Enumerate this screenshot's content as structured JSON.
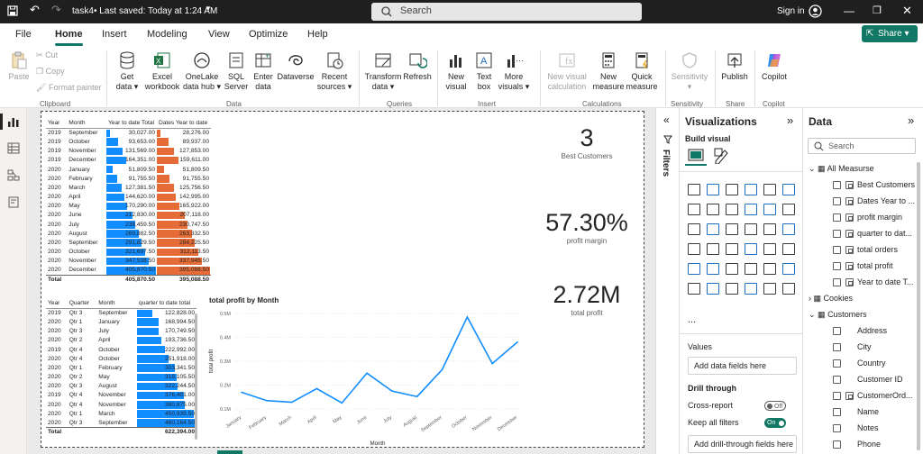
{
  "titlebar": {
    "file_name": "task4",
    "saved": "• Last saved: Today at 1:24 AM",
    "search": "Search",
    "signin": "Sign in"
  },
  "menu": [
    "File",
    "Home",
    "Insert",
    "Modeling",
    "View",
    "Optimize",
    "Help"
  ],
  "share": "Share",
  "ribbon": {
    "paste": "Paste",
    "cut": "Cut",
    "copy": "Copy",
    "format_painter": "Format painter",
    "get_data": "Get\ndata ▾",
    "excel": "Excel\nworkbook",
    "onelake": "OneLake\ndata hub ▾",
    "sql": "SQL\nServer",
    "enter_data": "Enter\ndata",
    "dataverse": "Dataverse",
    "recent": "Recent\nsources ▾",
    "transform": "Transform\ndata ▾",
    "refresh": "Refresh",
    "new_visual": "New\nvisual",
    "text_box": "Text\nbox",
    "more_visuals": "More\nvisuals ▾",
    "new_visual_calc": "New visual\ncalculation",
    "new_measure": "New\nmeasure",
    "quick_measure": "Quick\nmeasure",
    "sensitivity": "Sensitivity\n▾",
    "publish": "Publish",
    "copilot": "Copilot",
    "groups": {
      "clipboard": "Clipboard",
      "data": "Data",
      "queries": "Queries",
      "insert": "Insert",
      "calculations": "Calculations",
      "sensitivity": "Sensitivity",
      "share": "Share",
      "copilot": "Copilot"
    }
  },
  "matrix1": {
    "headers": [
      "Year",
      "Month",
      "Year to date Total",
      "Dates Year to date"
    ],
    "rows": [
      [
        "2019",
        "September",
        "30,027.00",
        "28,276.00"
      ],
      [
        "2019",
        "October",
        "93,653.00",
        "89,937.00"
      ],
      [
        "2019",
        "November",
        "131,569.00",
        "127,853.00"
      ],
      [
        "2019",
        "December",
        "164,351.00",
        "159,611.00"
      ],
      [
        "2020",
        "January",
        "51,809.50",
        "51,809.50"
      ],
      [
        "2020",
        "February",
        "91,755.50",
        "91,755.50"
      ],
      [
        "2020",
        "March",
        "127,381.50",
        "125,756.50"
      ],
      [
        "2020",
        "April",
        "144,620.00",
        "142,995.00"
      ],
      [
        "2020",
        "May",
        "170,290.00",
        "165,922.00"
      ],
      [
        "2020",
        "June",
        "212,830.00",
        "207,118.00"
      ],
      [
        "2020",
        "July",
        "238,459.50",
        "230,747.50"
      ],
      [
        "2020",
        "August",
        "269,882.50",
        "263,332.50"
      ],
      [
        "2020",
        "September",
        "291,829.50",
        "284,225.50"
      ],
      [
        "2020",
        "October",
        "321,697.50",
        "312,113.50"
      ],
      [
        "2020",
        "November",
        "347,538.50",
        "337,945.50"
      ],
      [
        "2020",
        "December",
        "405,870.50",
        "395,088.50"
      ]
    ],
    "total": [
      "Total",
      "",
      "405,870.50",
      "395,088.50"
    ]
  },
  "matrix2": {
    "headers": [
      "Year",
      "Quarter",
      "Month",
      "quarter to date total"
    ],
    "rows": [
      [
        "2019",
        "Qtr 3",
        "September",
        "122,828.00"
      ],
      [
        "2020",
        "Qtr 1",
        "January",
        "168,994.50"
      ],
      [
        "2020",
        "Qtr 3",
        "July",
        "170,749.50"
      ],
      [
        "2020",
        "Qtr 2",
        "April",
        "193,736.50"
      ],
      [
        "2019",
        "Qtr 4",
        "October",
        "222,992.00"
      ],
      [
        "2020",
        "Qtr 4",
        "October",
        "251,918.00"
      ],
      [
        "2020",
        "Qtr 1",
        "February",
        "303,341.50"
      ],
      [
        "2020",
        "Qtr 2",
        "May",
        "318,105.50"
      ],
      [
        "2020",
        "Qtr 3",
        "August",
        "322,244.50"
      ],
      [
        "2019",
        "Qtr 4",
        "November",
        "376,401.00"
      ],
      [
        "2020",
        "Qtr 4",
        "November",
        "380,875.00"
      ],
      [
        "2020",
        "Qtr 1",
        "March",
        "450,939.50"
      ],
      [
        "2020",
        "Qtr 3",
        "September",
        "460,164.50"
      ]
    ],
    "total": [
      "Total",
      "",
      "",
      "622,394.00"
    ]
  },
  "cards": [
    {
      "value": "3",
      "label": "Best Customers"
    },
    {
      "value": "57.30%",
      "label": "profit margin"
    },
    {
      "value": "2.72M",
      "label": "total profit"
    }
  ],
  "chart_data": {
    "type": "line",
    "title": "total profit by Month",
    "xlabel": "Month",
    "ylabel": "total profit",
    "categories": [
      "January",
      "February",
      "March",
      "April",
      "May",
      "June",
      "July",
      "August",
      "September",
      "October",
      "November",
      "December"
    ],
    "values": [
      170000,
      135000,
      128000,
      185000,
      125000,
      250000,
      175000,
      152000,
      265000,
      485000,
      290000,
      380000
    ],
    "yticks": [
      "0.1M",
      "0.2M",
      "0.3M",
      "0.4M",
      "0.5M"
    ],
    "ylim": [
      100000,
      500000
    ],
    "color": "#118dff"
  },
  "filters": {
    "label": "Filters"
  },
  "viz": {
    "title": "Visualizations",
    "build": "Build visual",
    "values": "Values",
    "add_data": "Add data fields here",
    "drill": "Drill through",
    "cross": "Cross-report",
    "cross_state": "Off",
    "keep": "Keep all filters",
    "keep_state": "On",
    "add_drill": "Add drill-through fields here",
    "more": "..."
  },
  "data_pane": {
    "title": "Data",
    "search": "Search",
    "tables": [
      {
        "name": "All Measurse",
        "fields": [
          "Best Customers",
          "Dates Year to ...",
          "profit margin",
          "quarter to dat...",
          "total orders",
          "total profit",
          "Year to date T..."
        ]
      },
      {
        "name": "Cookies",
        "fields": []
      },
      {
        "name": "Customers",
        "fields": [
          "Address",
          "City",
          "Country",
          "Customer ID",
          "CustomerOrd...",
          "Name",
          "Notes",
          "Phone"
        ]
      }
    ]
  }
}
